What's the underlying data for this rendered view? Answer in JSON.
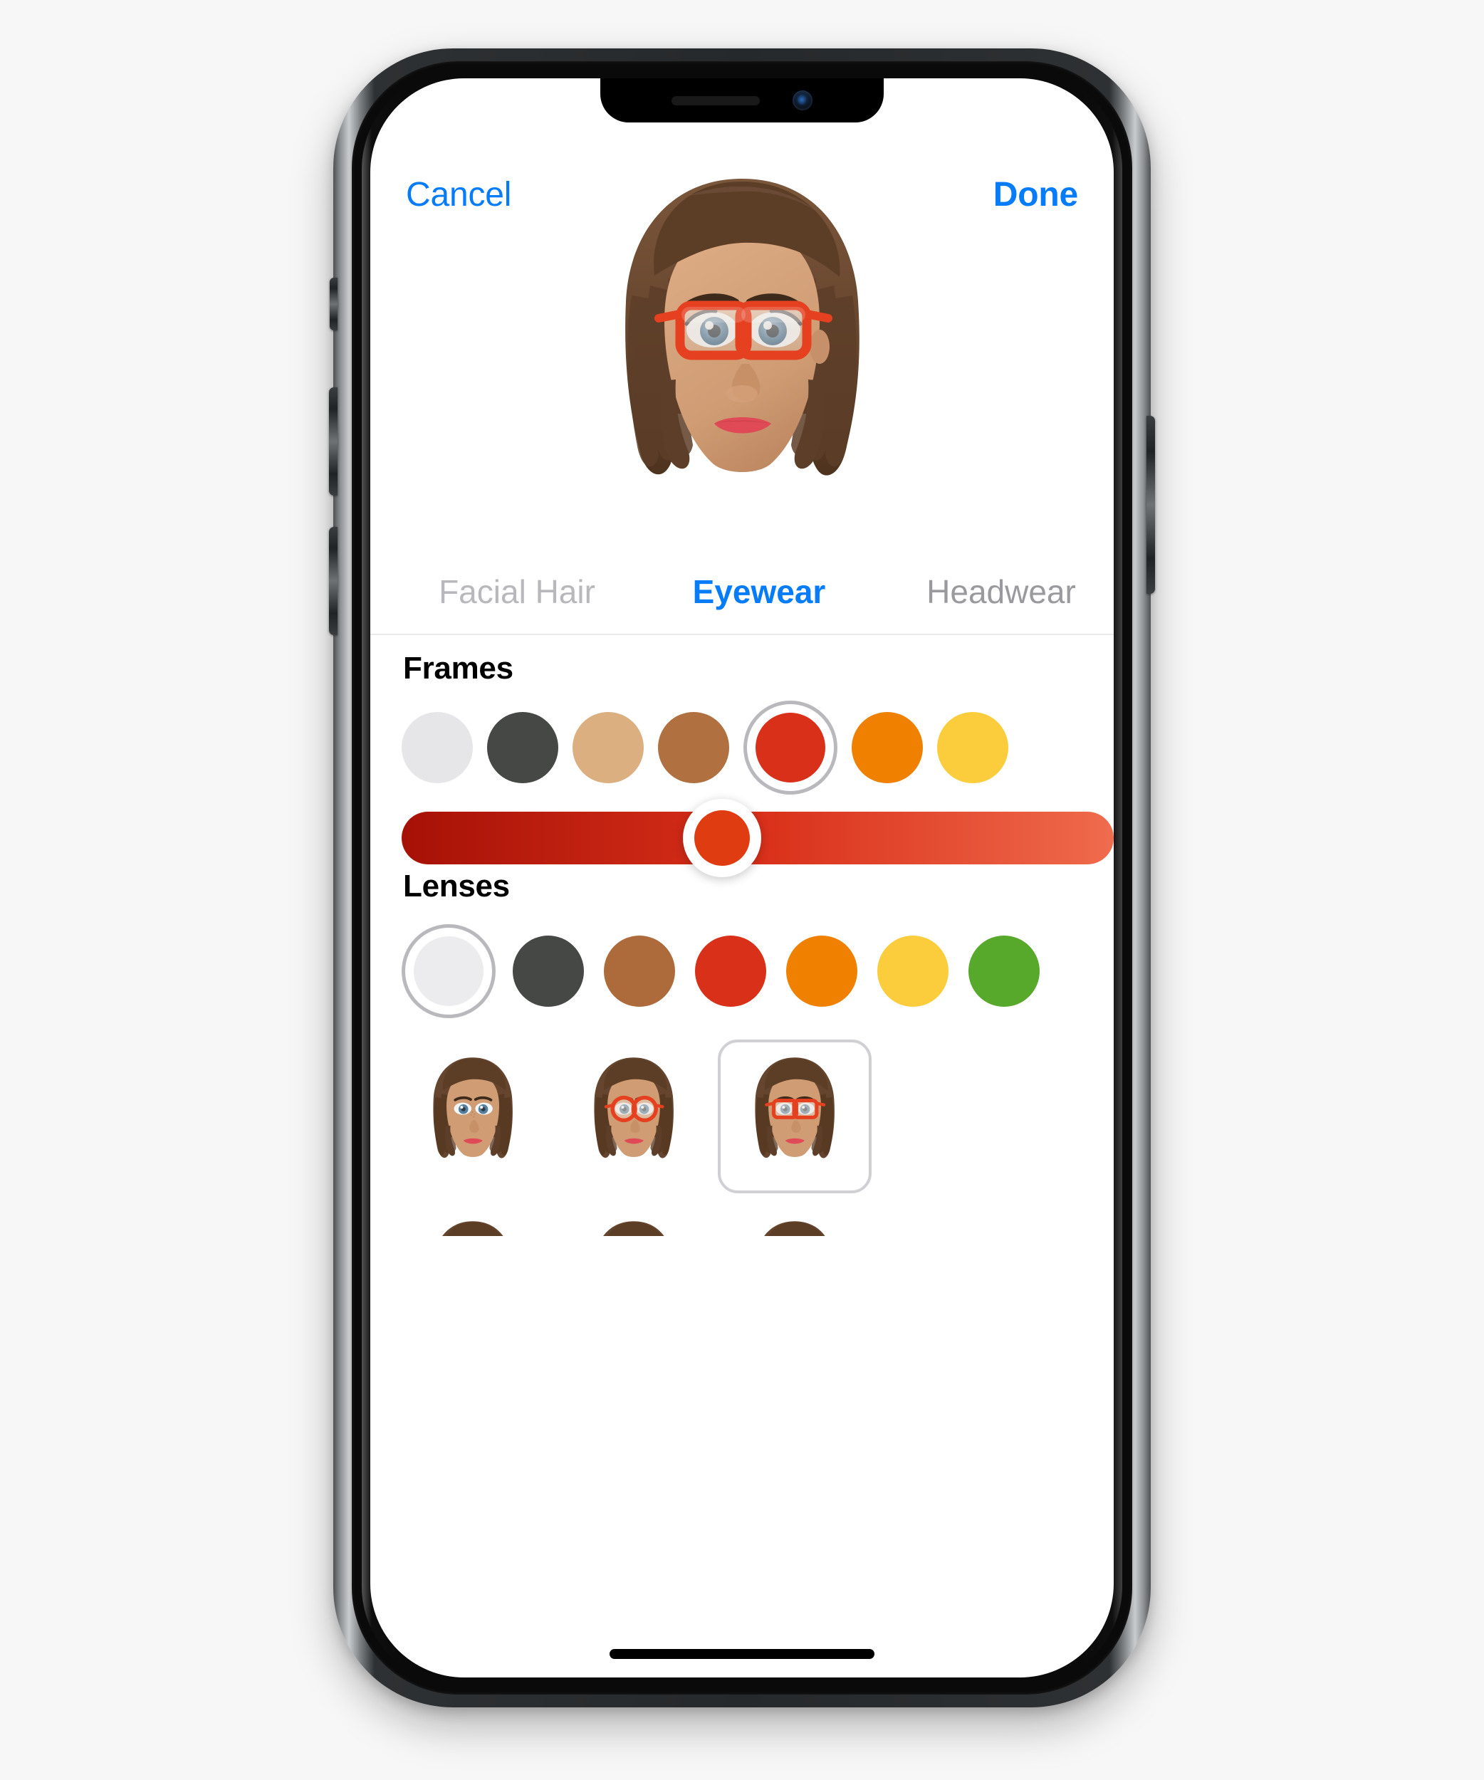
{
  "app": {
    "name": "Memoji Editor",
    "device": "iPhone X"
  },
  "navbar": {
    "cancel_label": "Cancel",
    "done_label": "Done",
    "accent_color": "#067cf9"
  },
  "tabs": [
    {
      "label": "Facial Hair",
      "active": false,
      "color": "#b8b8bc"
    },
    {
      "label": "Eyewear",
      "active": true,
      "color": "#067cf9"
    },
    {
      "label": "Headwear",
      "active": false,
      "color": "#9a9a9e"
    }
  ],
  "sections": {
    "frames": {
      "title": "Frames",
      "swatches": [
        {
          "name": "white",
          "color": "#e6e6e8",
          "selected": false
        },
        {
          "name": "charcoal",
          "color": "#464846",
          "selected": false
        },
        {
          "name": "tan",
          "color": "#dbaf7f",
          "selected": false
        },
        {
          "name": "brown",
          "color": "#b0703f",
          "selected": false
        },
        {
          "name": "red",
          "color": "#d9301a",
          "selected": true
        },
        {
          "name": "orange",
          "color": "#f08000",
          "selected": false
        },
        {
          "name": "yellow",
          "color": "#fbcc3c",
          "selected": false
        }
      ],
      "slider": {
        "name": "shade-slider",
        "value_percent": 45,
        "gradient_from": "#a61106",
        "gradient_mid": "#d9301a",
        "gradient_to": "#ef6a4b",
        "thumb_color": "#e03c12"
      }
    },
    "lenses": {
      "title": "Lenses",
      "swatches": [
        {
          "name": "white",
          "color": "#ececee",
          "selected": true
        },
        {
          "name": "charcoal",
          "color": "#464846",
          "selected": false
        },
        {
          "name": "brown",
          "color": "#ad6b3c",
          "selected": false
        },
        {
          "name": "red",
          "color": "#d9301a",
          "selected": false
        },
        {
          "name": "orange",
          "color": "#f08000",
          "selected": false
        },
        {
          "name": "yellow",
          "color": "#fbcc3c",
          "selected": false
        },
        {
          "name": "green",
          "color": "#56a92a",
          "selected": false
        }
      ]
    }
  },
  "eyewear_styles": [
    {
      "name": "none",
      "glasses": "none",
      "selected": false
    },
    {
      "name": "round-red",
      "glasses": "round",
      "selected": false
    },
    {
      "name": "square-red",
      "glasses": "rectangle",
      "selected": true
    }
  ],
  "avatar": {
    "name": "memoji-avatar",
    "skin": "#d4a07a",
    "skin_shadow": "#c08a63",
    "hair": "#6d4a32",
    "hair_dark": "#54361f",
    "hair_light": "#7e5a3d",
    "eye_iris": "#5c8ab0",
    "eye_white": "#f3f6f8",
    "lips": "#e04a56",
    "glasses_color": "#e5401f"
  },
  "selection_ring_color": "#b9b9bd",
  "divider_color": "#e9e9ea",
  "background_color": "#f7f7f7"
}
